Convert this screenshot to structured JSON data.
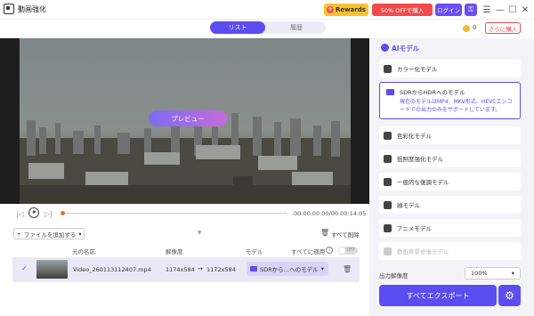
{
  "app": {
    "title": "動画強化"
  },
  "header": {
    "rewards_label": "Rewards",
    "offer_label": "50% OFFで購入",
    "login_label": "ログイン",
    "window_minimize": "—",
    "window_maximize": "☐",
    "window_close": "✕",
    "menu_icon": "☰"
  },
  "tabs": {
    "list": "リスト",
    "history": "履歴"
  },
  "coins": {
    "count": "0",
    "buy_more_label": "さらに購入"
  },
  "video": {
    "preview_label": "プレビュー",
    "timecode": "00:00:00.00/00:00:14.05",
    "progress": 0.0
  },
  "toolbar": {
    "add_file_label": "ファイルを追加する",
    "delete_all_label": "すべて削除"
  },
  "table": {
    "headers": {
      "name": "元の名前",
      "resolution": "解像度",
      "model": "モデル",
      "apply_all": "すべてに適用"
    },
    "toggle_text": "OFF",
    "rows": [
      {
        "filename": "Video_260113112407.mp4",
        "res_src": "1174x584",
        "arrow": "→",
        "res_dst": "1172x584",
        "model": "SDRから…へのモデル"
      }
    ]
  },
  "ai_panel": {
    "title": "AIモデル",
    "models": [
      {
        "label": "カラー化モデル",
        "icon": "color-brush-icon"
      },
      {
        "label": "SDRからHDRへのモデル",
        "icon": "hdr-icon",
        "selected": true,
        "desc": "現在のモデルはMP4、MKV形式、HEVCエンコードでの出力のみをサポートしています。"
      },
      {
        "label": "色彩化モデル",
        "icon": "palette-icon"
      },
      {
        "label": "低照度強化モデル",
        "icon": "moon-icon"
      },
      {
        "label": "一般的な復調モデル",
        "icon": "video-icon"
      },
      {
        "label": "顔モデル",
        "icon": "face-icon"
      },
      {
        "label": "アニメモデル",
        "icon": "anime-icon"
      },
      {
        "label": "動画背景修復モデル",
        "icon": "image-icon",
        "disabled": true
      }
    ],
    "output_label": "出力解像度",
    "resolution_value": "100%",
    "export_label": "すべてエクスポート"
  },
  "colors": {
    "accent": "#5b4df0",
    "rewards": "#f8c22e",
    "offer": "#ef4b4b"
  }
}
